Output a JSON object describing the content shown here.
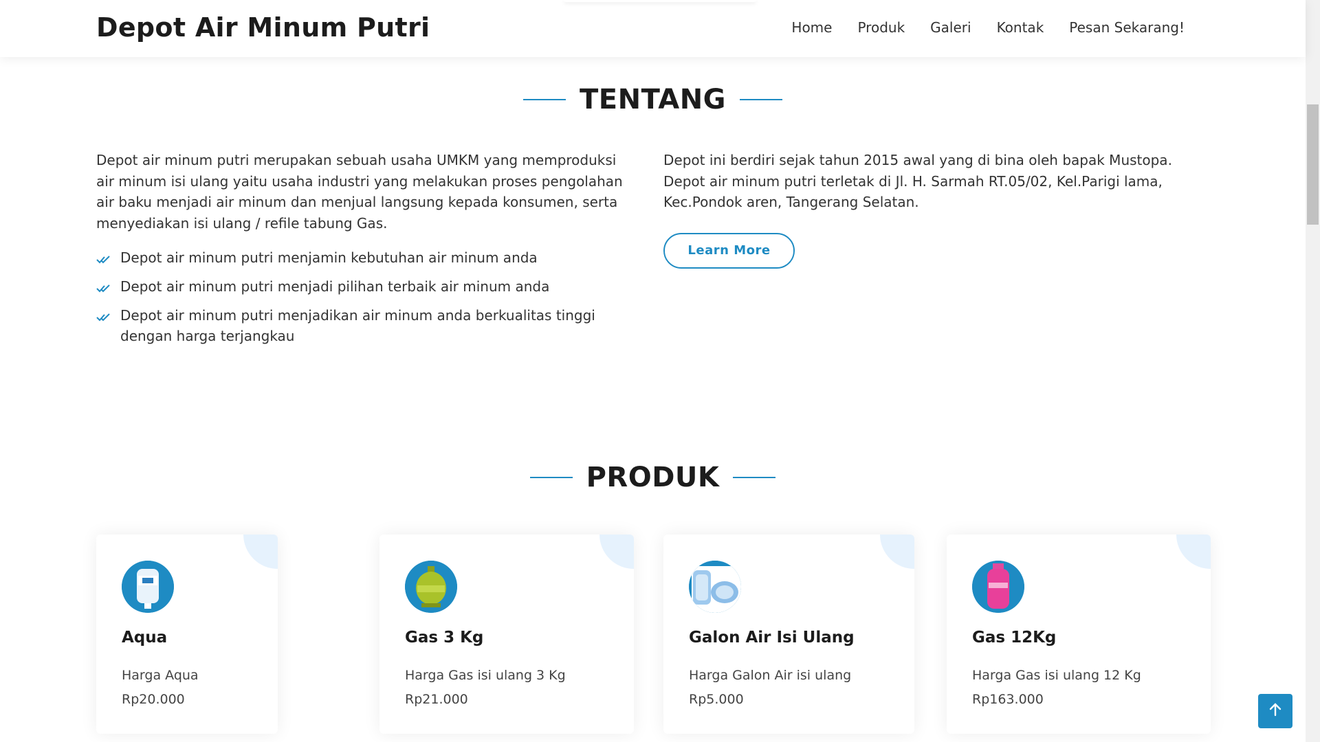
{
  "header": {
    "brand": "Depot Air Minum Putri",
    "nav": [
      "Home",
      "Produk",
      "Galeri",
      "Kontak",
      "Pesan Sekarang!"
    ]
  },
  "about": {
    "title": "TENTANG",
    "intro": "Depot air minum putri merupakan sebuah usaha UMKM yang memproduksi air minum isi ulang yaitu usaha industri yang melakukan proses pengolahan air baku menjadi air minum dan menjual langsung kepada konsumen, serta menyediakan isi ulang / refile tabung Gas.",
    "points": [
      "Depot air minum putri menjamin kebutuhan air minum anda",
      "Depot air minum putri menjadi pilihan terbaik air minum anda",
      "Depot air minum putri menjadikan air minum anda berkualitas tinggi dengan harga terjangkau"
    ],
    "history": "Depot ini berdiri sejak tahun 2015 awal yang di bina oleh bapak Mustopa. Depot air minum putri terletak di Jl. H. Sarmah RT.05/02, Kel.Parigi lama, Kec.Pondok aren, Tangerang Selatan.",
    "button": "Learn More"
  },
  "products": {
    "title": "PRODUK",
    "items": [
      {
        "name": "Aqua",
        "desc": "Harga Aqua Rp20.000",
        "icon": "water-gallon-icon"
      },
      {
        "name": "Gas 3 Kg",
        "desc": "Harga Gas isi ulang 3 Kg Rp21.000",
        "icon": "green-gas-cylinder-icon"
      },
      {
        "name": "Galon Air Isi Ulang",
        "desc": "Harga Galon Air isi ulang Rp5.000",
        "icon": "refill-gallon-icon"
      },
      {
        "name": "Gas 12Kg",
        "desc": "Harga Gas isi ulang 12 Kg Rp163.000",
        "icon": "pink-gas-cylinder-icon"
      }
    ]
  },
  "colors": {
    "accent": "#1e8bc3",
    "corner": "#e6f2fd",
    "heading": "#1c1c1c"
  },
  "back_to_top_icon": "arrow-up-icon"
}
